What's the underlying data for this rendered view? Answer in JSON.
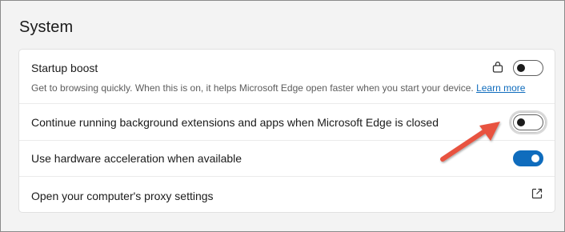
{
  "section": {
    "title": "System"
  },
  "settings": [
    {
      "label": "Startup boost",
      "description": "Get to browsing quickly. When this is on, it helps Microsoft Edge open faster when you start your device.",
      "link": "Learn more",
      "toggle": "off",
      "icon": "briefcase-lock-icon"
    },
    {
      "label": "Continue running background extensions and apps when Microsoft Edge is closed",
      "toggle": "off",
      "highlighted": true
    },
    {
      "label": "Use hardware acceleration when available",
      "toggle": "on"
    },
    {
      "label": "Open your computer's proxy settings",
      "icon": "external-link-icon"
    }
  ],
  "colors": {
    "accent": "#0f6cbd",
    "annotation_arrow": "#e8533f",
    "background": "#f3f3f3",
    "card": "#ffffff"
  }
}
